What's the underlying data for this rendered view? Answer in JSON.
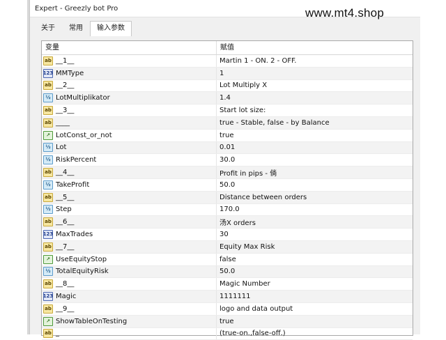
{
  "window": {
    "title": "Expert - Greezly bot Pro"
  },
  "watermark": "www.mt4.shop",
  "tabs": [
    {
      "label": "关于"
    },
    {
      "label": "常用"
    },
    {
      "label": "输入参数",
      "active": true
    }
  ],
  "table": {
    "headers": {
      "variable": "变量",
      "value": "赋值"
    },
    "rows": [
      {
        "icon": "text-param-icon",
        "glyph": "ab",
        "name": "__1__",
        "value": "Martin 1 - ON. 2 - OFF."
      },
      {
        "icon": "enum-param-icon",
        "glyph": "123",
        "name": "MMType",
        "value": "1"
      },
      {
        "icon": "text-param-icon",
        "glyph": "ab",
        "name": "__2__",
        "value": "Lot Multiply X"
      },
      {
        "icon": "number-param-icon",
        "glyph": "½",
        "name": "LotMultiplikator",
        "value": "1.4"
      },
      {
        "icon": "text-param-icon",
        "glyph": "ab",
        "name": "__3__",
        "value": "Start lot size:"
      },
      {
        "icon": "text-param-icon",
        "glyph": "ab",
        "name": "____",
        "value": "true - Stable, false - by Balance"
      },
      {
        "icon": "bool-param-icon",
        "glyph": "↗",
        "name": "LotConst_or_not",
        "value": "true"
      },
      {
        "icon": "number-param-icon",
        "glyph": "½",
        "name": "Lot",
        "value": "0.01"
      },
      {
        "icon": "number-param-icon",
        "glyph": "½",
        "name": "RiskPercent",
        "value": "30.0"
      },
      {
        "icon": "text-param-icon",
        "glyph": "ab",
        "name": "__4__",
        "value": "Profit in pips - 倘"
      },
      {
        "icon": "number-param-icon",
        "glyph": "½",
        "name": "TakeProfit",
        "value": "50.0"
      },
      {
        "icon": "text-param-icon",
        "glyph": "ab",
        "name": "__5__",
        "value": "Distance between orders"
      },
      {
        "icon": "number-param-icon",
        "glyph": "½",
        "name": "Step",
        "value": "170.0"
      },
      {
        "icon": "text-param-icon",
        "glyph": "ab",
        "name": "__6__",
        "value": "汤X orders"
      },
      {
        "icon": "enum-param-icon",
        "glyph": "123",
        "name": "MaxTrades",
        "value": "30"
      },
      {
        "icon": "text-param-icon",
        "glyph": "ab",
        "name": "__7__",
        "value": "Equity Max Risk"
      },
      {
        "icon": "bool-param-icon",
        "glyph": "↗",
        "name": "UseEquityStop",
        "value": "false"
      },
      {
        "icon": "number-param-icon",
        "glyph": "½",
        "name": "TotalEquityRisk",
        "value": "50.0"
      },
      {
        "icon": "text-param-icon",
        "glyph": "ab",
        "name": "__8__",
        "value": "Magic Number"
      },
      {
        "icon": "enum-param-icon",
        "glyph": "123",
        "name": "Magic",
        "value": "1111111"
      },
      {
        "icon": "text-param-icon",
        "glyph": "ab",
        "name": "__9__",
        "value": "logo and data output"
      },
      {
        "icon": "bool-param-icon",
        "glyph": "↗",
        "name": "ShowTableOnTesting",
        "value": "true"
      },
      {
        "icon": "text-param-icon",
        "glyph": "ab",
        "name": "_",
        "value": "(true-on.,false-off.)"
      }
    ]
  }
}
